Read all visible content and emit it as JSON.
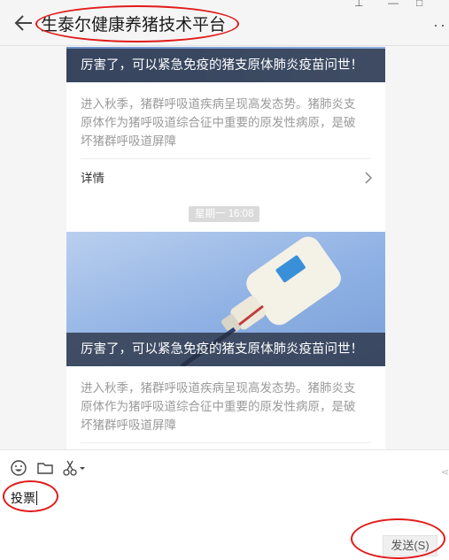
{
  "header": {
    "title": "生泰尔健康养猪技术平台",
    "more_label": "··"
  },
  "messages": [
    {
      "caption": "厉害了，可以紧急免疫的猪支原体肺炎疫苗问世！",
      "description_lines": [
        "进入秋季，猪群呼吸道疾病呈现高发态势。猪肺炎支",
        "原体作为猪呼吸道综合征中重要的原发性病原，是破",
        "坏猪群呼吸道屏障"
      ],
      "detail_label": "详情"
    },
    {
      "timestamp": "星期一 16:08",
      "caption": "厉害了，可以紧急免疫的猪支原体肺炎疫苗问世！",
      "description_lines": [
        "进入秋季，猪群呼吸道疾病呈现高发态势。猪肺炎支",
        "原体作为猪呼吸道综合征中重要的原发性病原，是破",
        "坏猪群呼吸道屏障"
      ]
    }
  ],
  "composer": {
    "input_value": "投票",
    "send_label": "发送(S)",
    "tools": [
      "emoji-icon",
      "folder-icon",
      "scissors-icon"
    ]
  },
  "colors": {
    "annotation_red": "#e21a1a",
    "caption_bg": "#283040",
    "page_bg": "#f5f5f5"
  }
}
